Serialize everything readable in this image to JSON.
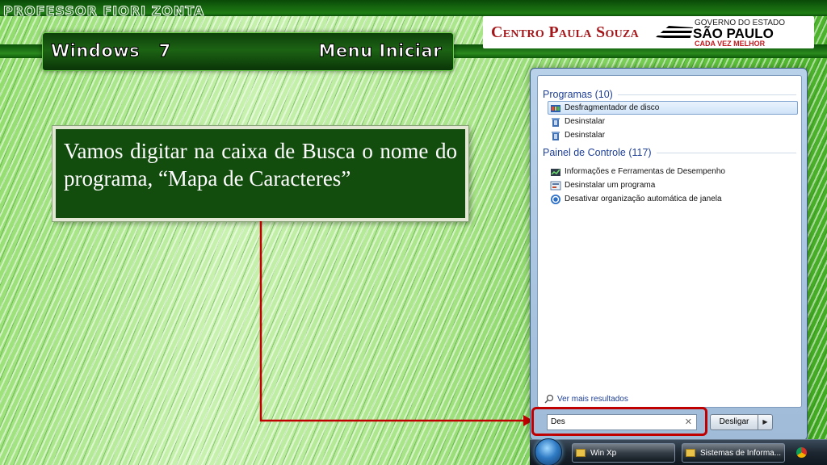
{
  "header": {
    "professor": "PROFESSOR FIORI ZONTA",
    "section_left": "Windows   7",
    "section_right": "Menu Iniciar"
  },
  "logos": {
    "cps": "Centro Paula Souza",
    "gov_line1": "GOVERNO DO ESTADO",
    "gov_line2": "SÃO PAULO",
    "gov_line3": "CADA VEZ MELHOR"
  },
  "callout": {
    "text": "Vamos digitar na caixa de Busca o nome do programa, “Mapa de Caracteres”"
  },
  "start_menu": {
    "programs_heading": "Programas (10)",
    "programs": [
      {
        "label": "Desfragmentador de disco",
        "icon": "defrag-icon",
        "selected": true
      },
      {
        "label": "Desinstalar",
        "icon": "uninstall-icon",
        "selected": false
      },
      {
        "label": "Desinstalar",
        "icon": "uninstall-icon",
        "selected": false
      }
    ],
    "control_panel_heading": "Painel de Controle (117)",
    "control_panel": [
      {
        "label": "Informações e Ferramentas de Desempenho",
        "icon": "performance-icon"
      },
      {
        "label": "Desinstalar um programa",
        "icon": "programs-icon"
      },
      {
        "label": "Desativar organização automática de janela",
        "icon": "ease-of-access-icon"
      }
    ],
    "more_results": "Ver mais resultados",
    "search_value": "Des",
    "shutdown_label": "Desligar"
  },
  "taskbar": {
    "tasks": [
      "Win Xp",
      "Sistemas de Informa..."
    ]
  },
  "colors": {
    "callout_bg": "#124d0e",
    "arrow": "#c00000",
    "link_blue": "#1e3f96"
  }
}
